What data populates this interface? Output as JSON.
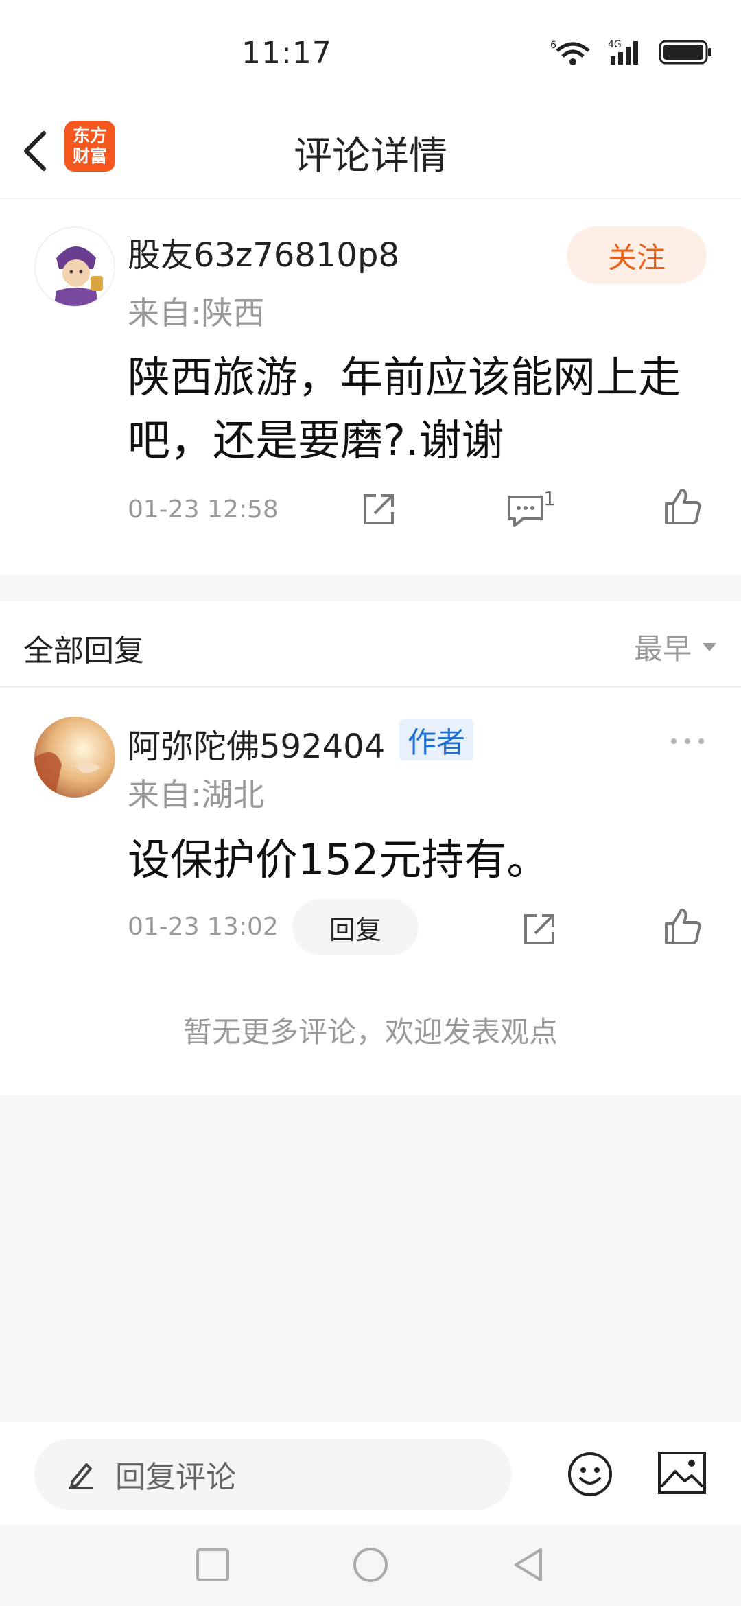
{
  "status_bar": {
    "time": "11:17",
    "wifi_label": "6",
    "network_label": "4G"
  },
  "header": {
    "title": "评论详情",
    "logo_line1": "东方",
    "logo_line2": "财富"
  },
  "post": {
    "username": "股友63z76810p8",
    "location": "来自:陕西",
    "follow_label": "关注",
    "body": "陕西旅游，年前应该能网上走吧，还是要磨?.谢谢",
    "time": "01-23 12:58",
    "comment_count": "1"
  },
  "replies": {
    "title": "全部回复",
    "sort_label": "最早",
    "items": [
      {
        "username": "阿弥陀佛592404",
        "badge": "作者",
        "location": "来自:湖北",
        "body": "设保护价152元持有。",
        "time": "01-23 13:02",
        "reply_label": "回复"
      }
    ],
    "no_more_text": "暂无更多评论，欢迎发表观点"
  },
  "bottom_bar": {
    "input_placeholder": "回复评论"
  },
  "colors": {
    "accent": "#f4581f",
    "follow_text": "#e8621c",
    "author_badge": "#1f6fd0",
    "page_bg": "#f5f6f8"
  },
  "icons": [
    "back-arrow-icon",
    "app-logo",
    "share-icon",
    "comment-icon",
    "like-icon",
    "more-icon",
    "sort-down-icon",
    "pen-icon",
    "emoji-icon",
    "image-icon"
  ]
}
